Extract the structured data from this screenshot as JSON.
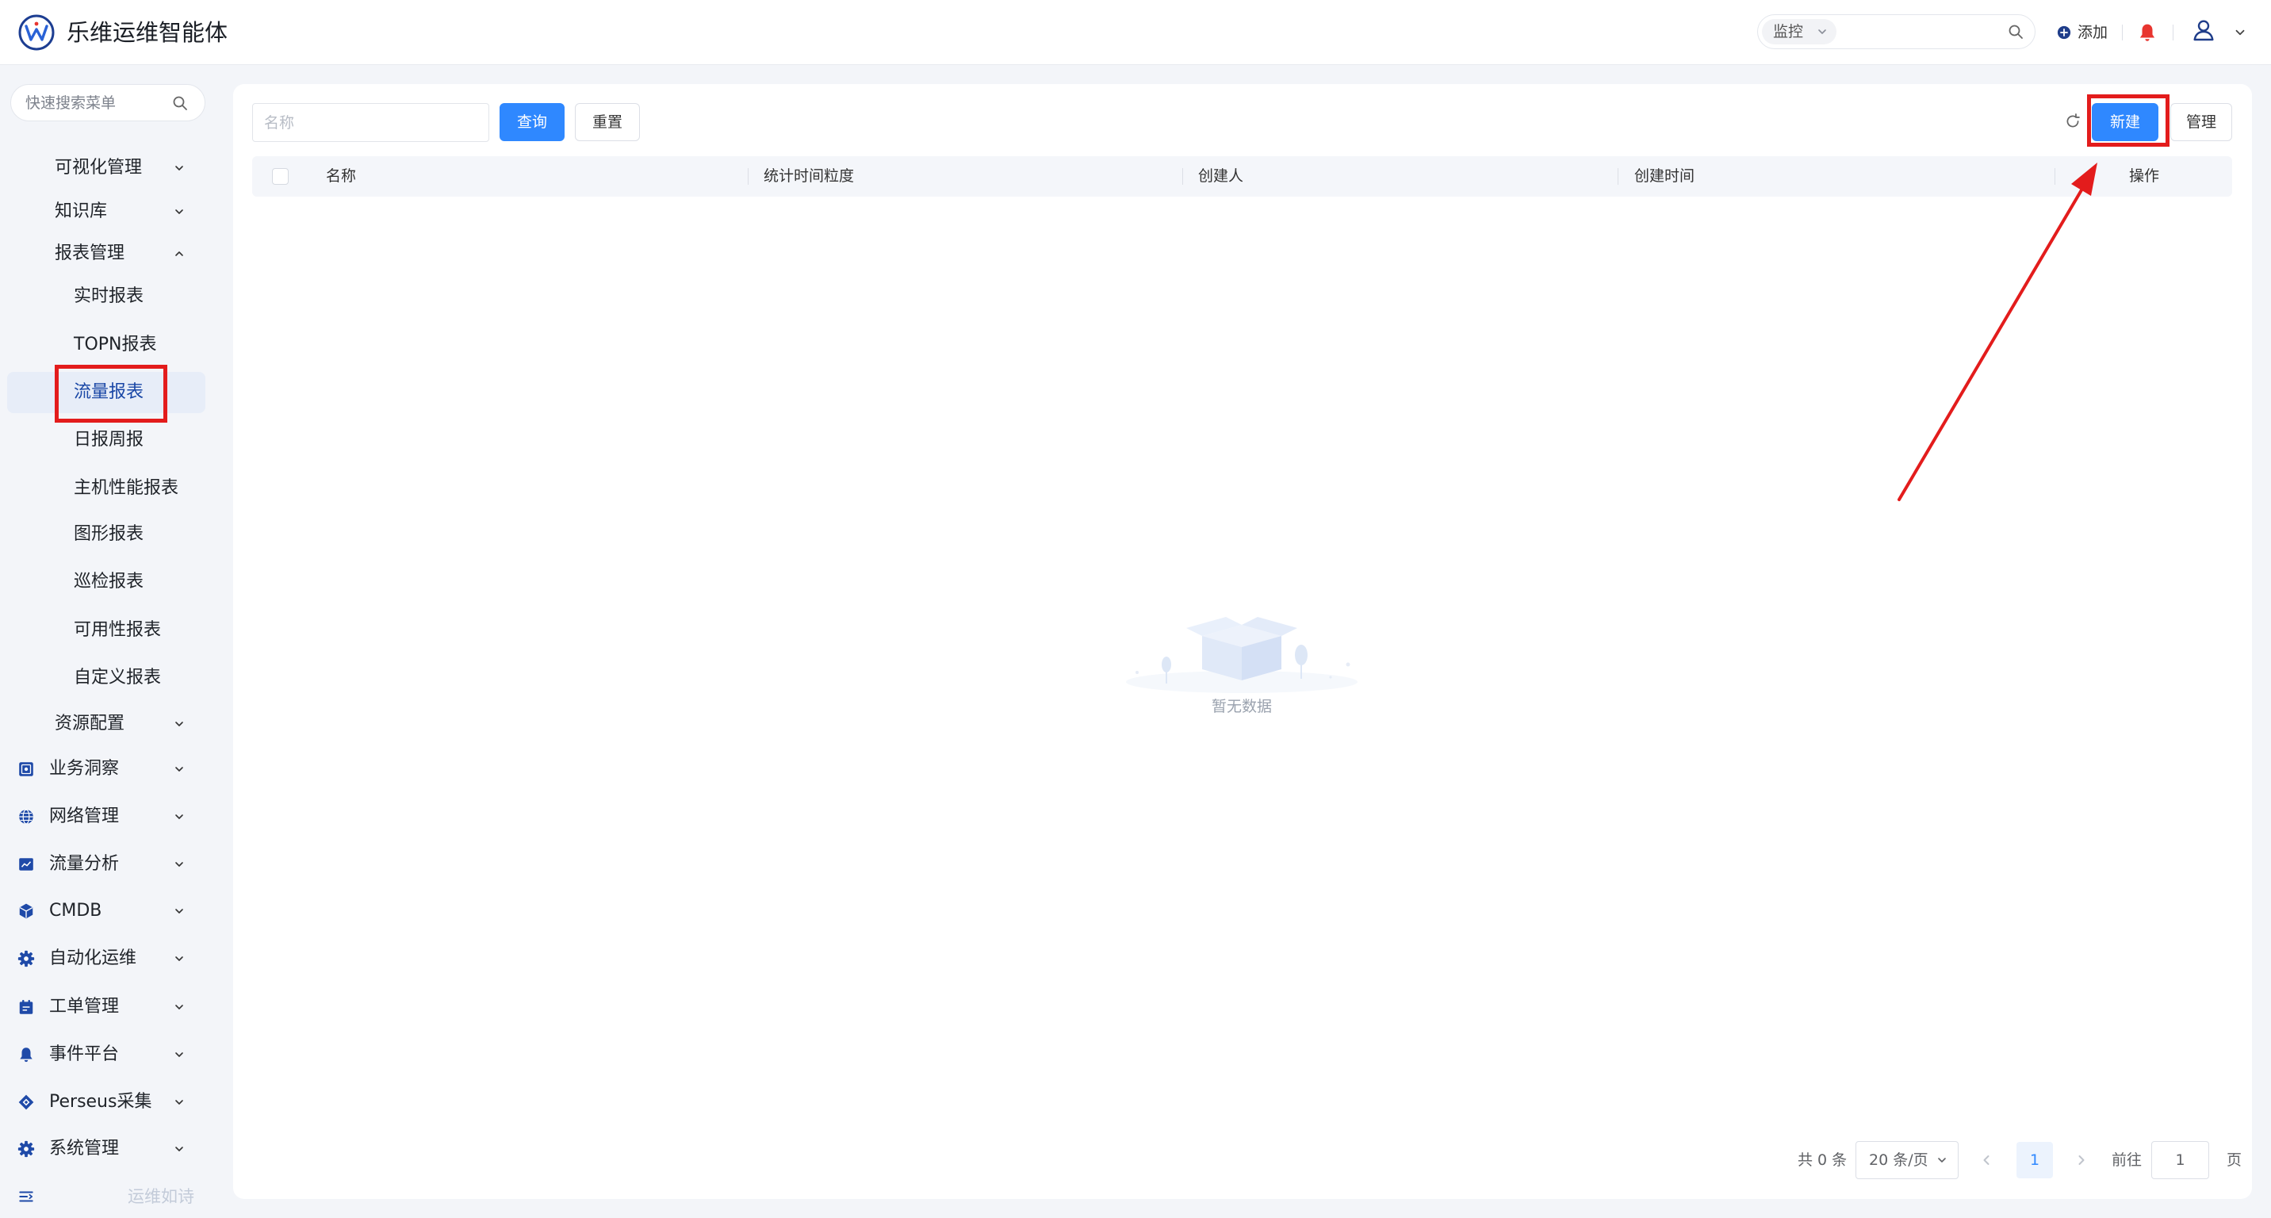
{
  "app": {
    "title": "乐维运维智能体",
    "logo_icon": "lewei-logo"
  },
  "header": {
    "module_select": "监控",
    "add_label": "添加",
    "icons": {
      "search": "search-icon",
      "add": "plus-circle-icon",
      "notifications": "bell-icon",
      "user": "user-icon",
      "menu_toggle": "chevron-down-icon"
    }
  },
  "sidebar": {
    "search_placeholder": "快速搜索菜单",
    "items": [
      {
        "label": "可视化管理",
        "depth": 1,
        "expanded": false
      },
      {
        "label": "知识库",
        "depth": 1,
        "expanded": false
      },
      {
        "label": "报表管理",
        "depth": 1,
        "expanded": true
      },
      {
        "label": "实时报表",
        "depth": 2
      },
      {
        "label": "TOPN报表",
        "depth": 2
      },
      {
        "label": "流量报表",
        "depth": 2,
        "selected": true
      },
      {
        "label": "日报周报",
        "depth": 2
      },
      {
        "label": "主机性能报表",
        "depth": 2
      },
      {
        "label": "图形报表",
        "depth": 2
      },
      {
        "label": "巡检报表",
        "depth": 2
      },
      {
        "label": "可用性报表",
        "depth": 2
      },
      {
        "label": "自定义报表",
        "depth": 2
      },
      {
        "label": "资源配置",
        "depth": 1,
        "expanded": false
      },
      {
        "label": "业务洞察",
        "depth": 0,
        "icon": "dashboard-icon",
        "expanded": false
      },
      {
        "label": "网络管理",
        "depth": 0,
        "icon": "globe-icon",
        "expanded": false
      },
      {
        "label": "流量分析",
        "depth": 0,
        "icon": "line-chart-icon",
        "expanded": false
      },
      {
        "label": "CMDB",
        "depth": 0,
        "icon": "cube-icon",
        "expanded": false
      },
      {
        "label": "自动化运维",
        "depth": 0,
        "icon": "gear-icon",
        "expanded": false
      },
      {
        "label": "工单管理",
        "depth": 0,
        "icon": "calendar-ticket-icon",
        "expanded": false
      },
      {
        "label": "事件平台",
        "depth": 0,
        "icon": "bell-icon",
        "expanded": false
      },
      {
        "label": "Perseus采集",
        "depth": 0,
        "icon": "diamond-icon",
        "expanded": false
      },
      {
        "label": "系统管理",
        "depth": 0,
        "icon": "gear-icon",
        "expanded": false
      }
    ],
    "footer_icon": "menu-collapse-icon",
    "footer_text": "运维如诗"
  },
  "toolbar": {
    "name_placeholder": "名称",
    "query_label": "查询",
    "reset_label": "重置",
    "create_label": "新建",
    "manage_label": "管理",
    "refresh_icon": "refresh-icon"
  },
  "table": {
    "columns": [
      "名称",
      "统计时间粒度",
      "创建人",
      "创建时间",
      "操作"
    ],
    "rows": [],
    "empty_text": "暂无数据"
  },
  "pagination": {
    "total_text": "共 0 条",
    "page_size": "20 条/页",
    "current_page": "1",
    "goto_label": "前往",
    "goto_value": "1",
    "page_suffix": "页"
  },
  "colors": {
    "primary": "#2f88ff",
    "selected_bg": "#e7edf8",
    "nav_icon": "#1f4aa8",
    "bell": "#e8352f",
    "annotation": "#e31c1c"
  }
}
